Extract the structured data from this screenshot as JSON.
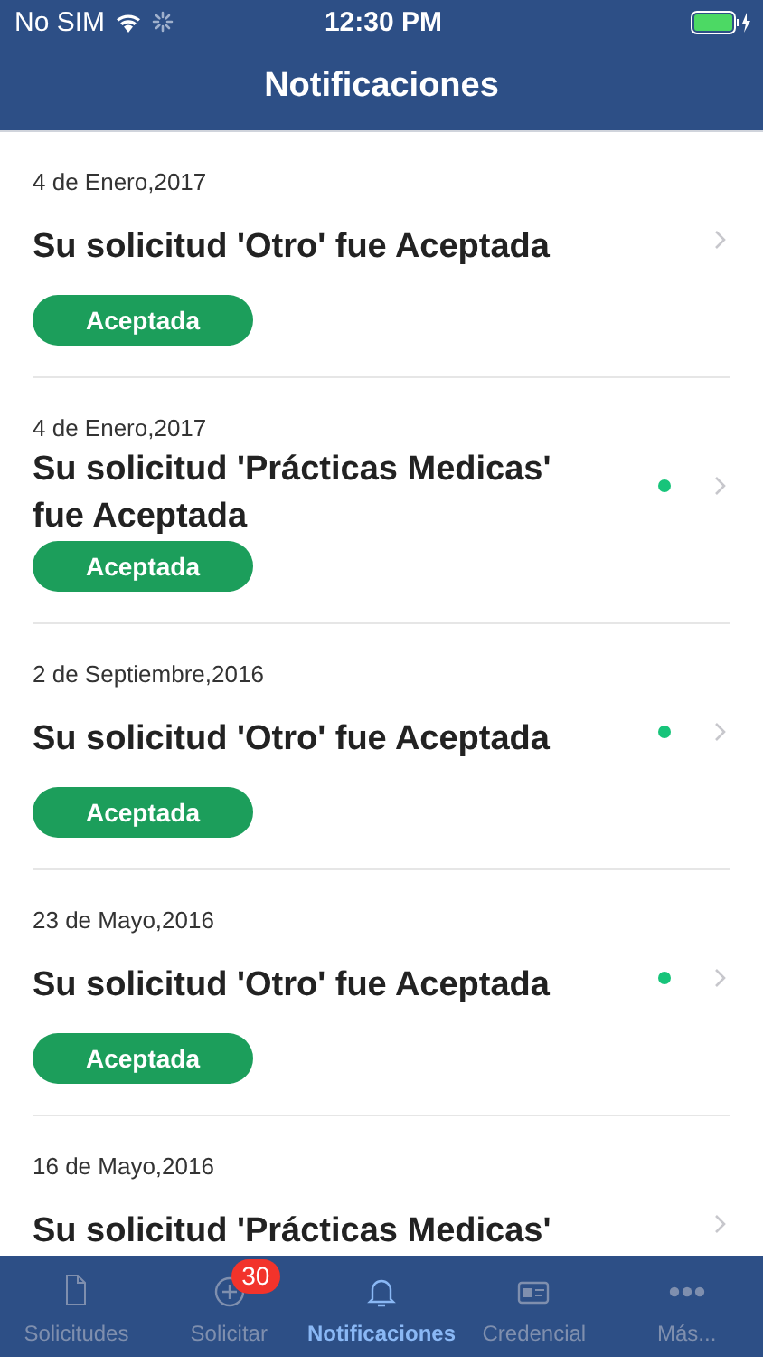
{
  "status_bar": {
    "carrier": "No SIM",
    "time": "12:30 PM"
  },
  "nav_bar": {
    "title": "Notificaciones"
  },
  "notifications": [
    {
      "date": "4 de Enero,2017",
      "title": "Su solicitud 'Otro' fue Aceptada",
      "unread": false,
      "status": "Aceptada"
    },
    {
      "date": "4 de Enero,2017",
      "title": "Su solicitud 'Prácticas Medicas' fue Aceptada",
      "unread": true,
      "status": "Aceptada"
    },
    {
      "date": "2 de Septiembre,2016",
      "title": "Su solicitud 'Otro' fue Aceptada",
      "unread": true,
      "status": "Aceptada"
    },
    {
      "date": "23 de Mayo,2016",
      "title": "Su solicitud 'Otro' fue Aceptada",
      "unread": true,
      "status": "Aceptada"
    },
    {
      "date": "16 de Mayo,2016",
      "title": "Su solicitud 'Prácticas Medicas'",
      "unread": false
    }
  ],
  "tab_bar": [
    {
      "kind": "document",
      "label": "Solicitudes",
      "selected": false
    },
    {
      "kind": "plus",
      "label": "Solicitar",
      "selected": false,
      "badge": "30"
    },
    {
      "kind": "bell",
      "label": "Notificaciones",
      "selected": true
    },
    {
      "kind": "card",
      "label": "Credencial",
      "selected": false
    },
    {
      "kind": "more",
      "label": "Más...",
      "selected": false
    }
  ]
}
